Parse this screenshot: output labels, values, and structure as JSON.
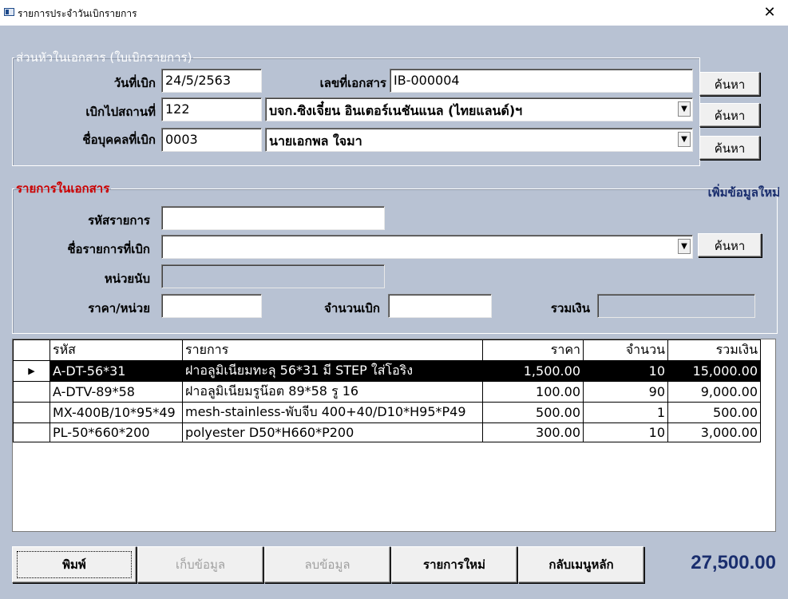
{
  "window": {
    "title": "รายการประจำวันเบิกรายการ",
    "close_glyph": "✕"
  },
  "header_group": {
    "legend": "ส่วนหัวในเอกสาร (ใบเบิกรายการ)",
    "date_label": "วันที่เบิก",
    "date_value": "24/5/2563",
    "docno_label": "เลขที่เอกสาร",
    "docno_value": "IB-000004",
    "location_label": "เบิกไปสถานที่",
    "location_code": "122",
    "location_name": "บจก.ซิงเจี๋ยน อินเตอร์เนชันแนล (ไทยแลนด์)ฯ",
    "person_label": "ชื่อบุคคลที่เบิก",
    "person_code": "0003",
    "person_name": "นายเอกพล ใจมา",
    "search_label": "ค้นหา"
  },
  "items_group": {
    "legend": "รายการในเอกสาร",
    "add_new_label": "เพิ่มข้อมูลใหม่",
    "code_label": "รหัสรายการ",
    "code_value": "",
    "name_label": "ชื่อรายการที่เบิก",
    "name_value": "",
    "unit_label": "หน่วยนับ",
    "unit_value": "",
    "price_label": "ราคา/หน่วย",
    "price_value": "",
    "qty_label": "จำนวนเบิก",
    "qty_value": "",
    "sum_label": "รวมเงิน",
    "sum_value": "",
    "search_label": "ค้นหา"
  },
  "grid": {
    "columns": [
      "รหัส",
      "รายการ",
      "ราคา",
      "จำนวน",
      "รวมเงิน"
    ],
    "selected_row": 0,
    "row_indicator": "▶",
    "rows": [
      {
        "code": "A-DT-56*31",
        "name": "ฝาอลูมิเนียมทะลุ 56*31 มี STEP ใส่โอริง",
        "price": "1,500.00",
        "qty": "10",
        "total": "15,000.00"
      },
      {
        "code": "A-DTV-89*58",
        "name": "ฝาอลูมิเนียมรูน๊อต 89*58 รู 16",
        "price": "100.00",
        "qty": "90",
        "total": "9,000.00"
      },
      {
        "code": "MX-400B/10*95*49",
        "name": "mesh-stainless-พับจีบ 400+40/D10*H95*P49",
        "price": "500.00",
        "qty": "1",
        "total": "500.00"
      },
      {
        "code": "PL-50*660*200",
        "name": "polyester D50*H660*P200",
        "price": "300.00",
        "qty": "10",
        "total": "3,000.00"
      }
    ]
  },
  "footer": {
    "print_label": "พิมพ์",
    "save_label": "เก็บข้อมูล",
    "delete_label": "ลบข้อมูล",
    "new_label": "รายการใหม่",
    "back_label": "กลับเมนูหลัก",
    "grand_total": "27,500.00"
  },
  "colors": {
    "form_background": "#b8c2d3",
    "accent_text": "#1a2e6e",
    "legend_red": "#cc0000"
  }
}
